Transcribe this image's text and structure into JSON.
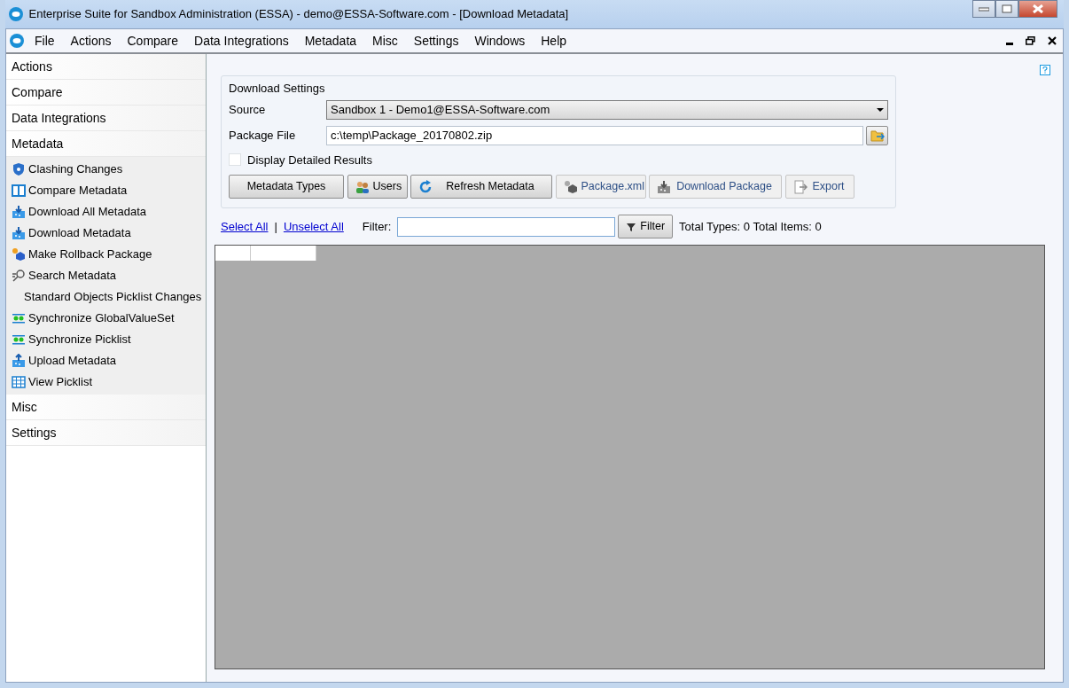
{
  "window": {
    "title": "Enterprise Suite for Sandbox Administration (ESSA) - demo@ESSA-Software.com - [Download Metadata]"
  },
  "menu": [
    "File",
    "Actions",
    "Compare",
    "Data Integrations",
    "Metadata",
    "Misc",
    "Settings",
    "Windows",
    "Help"
  ],
  "sidebar": {
    "sections": [
      {
        "label": "Actions"
      },
      {
        "label": "Compare"
      },
      {
        "label": "Data Integrations"
      },
      {
        "label": "Metadata",
        "items": [
          {
            "label": "Clashing Changes",
            "kind": "shield"
          },
          {
            "label": "Compare Metadata",
            "kind": "columns"
          },
          {
            "label": "Download All Metadata",
            "kind": "download"
          },
          {
            "label": "Download Metadata",
            "kind": "download"
          },
          {
            "label": "Make Rollback Package",
            "kind": "package"
          },
          {
            "label": "Search Metadata",
            "kind": "search"
          },
          {
            "label": "Standard Objects Picklist Changes",
            "kind": "none"
          },
          {
            "label": "Synchronize GlobalValueSet",
            "kind": "sync"
          },
          {
            "label": "Synchronize Picklist",
            "kind": "sync"
          },
          {
            "label": "Upload Metadata",
            "kind": "upload"
          },
          {
            "label": "View Picklist",
            "kind": "grid"
          }
        ]
      },
      {
        "label": "Misc"
      },
      {
        "label": "Settings"
      }
    ]
  },
  "download_settings": {
    "title": "Download Settings",
    "source": {
      "label": "Source",
      "value": "Sandbox 1 - Demo1@ESSA-Software.com"
    },
    "package_file": {
      "label": "Package File",
      "value": "c:\\temp\\Package_20170802.zip"
    },
    "display_detailed_results": {
      "label": "Display Detailed Results",
      "checked": false
    },
    "buttons": [
      {
        "label": "Metadata Types",
        "kind": "plain",
        "disabled": false
      },
      {
        "label": "Users",
        "kind": "users",
        "disabled": false
      },
      {
        "label": "Refresh Metadata",
        "kind": "refresh",
        "disabled": false
      },
      {
        "label": "Package.xml",
        "kind": "package",
        "disabled": true
      },
      {
        "label": "Download Package",
        "kind": "download",
        "disabled": true
      },
      {
        "label": "Export",
        "kind": "export",
        "disabled": true
      }
    ]
  },
  "toolbar": {
    "select_all": "Select All",
    "separator": "|",
    "unselect_all": "Unselect All",
    "filter_label": "Filter:",
    "filter_button": "Filter",
    "totals": "Total Types: 0 Total Items: 0"
  }
}
